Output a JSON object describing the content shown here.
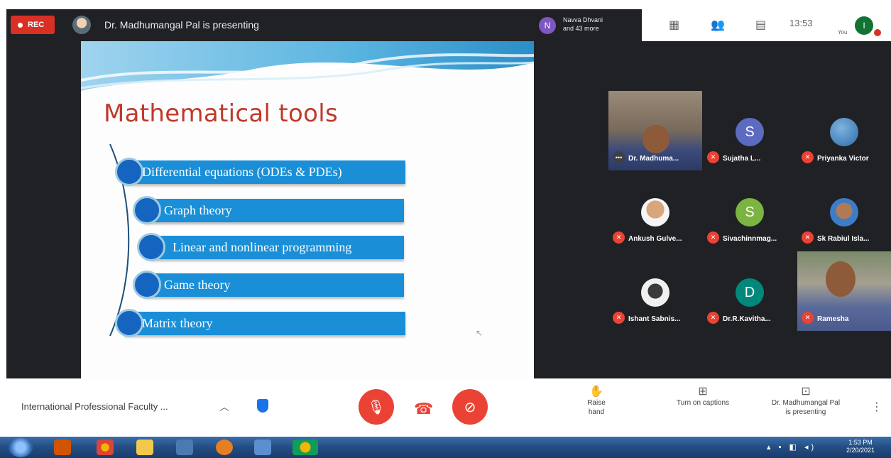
{
  "top_bar": {
    "rec_label": "REC",
    "presenting_text": "Dr. Madhumangal Pal is presenting",
    "raise_avatar_initial": "N",
    "raise_text_line1": "Navva Dhvani",
    "raise_text_line2": "and 43 more",
    "time": "13:53",
    "you_label": "You",
    "user_initial": "I"
  },
  "slide": {
    "title": "Mathematical tools",
    "items": [
      "Differential equations (ODEs & PDEs)",
      "Graph theory",
      "Linear and nonlinear programming",
      "Game theory",
      "Matrix theory"
    ],
    "accent_color": "#1a8fd8",
    "title_color": "#c0392b"
  },
  "participants": [
    {
      "name": "Dr. Madhuma...",
      "avatar": "video"
    },
    {
      "name": "Sujatha L...",
      "initial": "S",
      "color": "#5c6bc0"
    },
    {
      "name": "Priyanka Victor",
      "avatar": "photo"
    },
    {
      "name": "Ankush Gulve...",
      "avatar": "photo"
    },
    {
      "name": "Sivachinnmag...",
      "initial": "S",
      "color": "#7cb342"
    },
    {
      "name": "Sk Rabiul Isla...",
      "avatar": "photo"
    },
    {
      "name": "Ishant Sabnis...",
      "avatar": "photo"
    },
    {
      "name": "Dr.R.Kavitha...",
      "initial": "D",
      "color": "#00897b"
    },
    {
      "name": "Ramesha",
      "avatar": "video"
    }
  ],
  "bottom_bar": {
    "meeting_name": "International Professional Faculty ...",
    "raise_hand_label": "Raise hand",
    "captions_label": "Turn on captions",
    "presenting_label_line1": "Dr. Madhumangal Pal",
    "presenting_label_line2": "is presenting"
  },
  "taskbar": {
    "clock_time": "1:53 PM",
    "clock_date": "2/20/2021"
  }
}
